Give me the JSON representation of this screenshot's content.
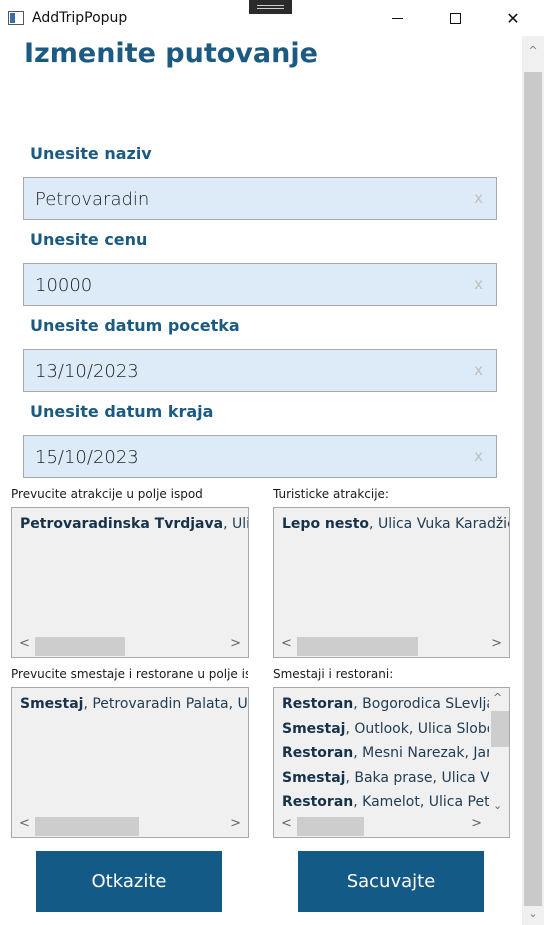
{
  "window": {
    "title": "AddTripPopup",
    "minimize_icon": "minimize-icon",
    "maximize_icon": "maximize-icon",
    "close_icon": "close-icon",
    "close_glyph": "✕"
  },
  "page": {
    "title": "Izmenite putovanje"
  },
  "fields": [
    {
      "label": "Unesite naziv",
      "value": "Petrovaradin",
      "clear": "x"
    },
    {
      "label": "Unesite cenu",
      "value": "10000",
      "clear": "x"
    },
    {
      "label": "Unesite datum pocetka",
      "value": "13/10/2023",
      "clear": "x"
    },
    {
      "label": "Unesite datum kraja",
      "value": "15/10/2023",
      "clear": "x"
    }
  ],
  "lists": {
    "selected_attractions": {
      "label": "Prevucite atrakcije u polje ispod",
      "items": [
        {
          "type": "Petrovaradinska Tvrdjava",
          "detail": ", Ulica Tr"
        }
      ]
    },
    "attractions": {
      "label": "Turisticke atrakcije:",
      "items": [
        {
          "type": "Lepo nesto",
          "detail": ", Ulica Vuka Karadžića"
        }
      ]
    },
    "selected_accommodations": {
      "label": "Prevucite smestaje i restorane u polje ispod",
      "items": [
        {
          "type": "Smestaj",
          "detail": ", Petrovaradin Palata, Ulic"
        }
      ]
    },
    "accommodations": {
      "label": "Smestaji i restorani:",
      "items": [
        {
          "type": "Restoran",
          "detail": ", Bogorodica SLevlja, U"
        },
        {
          "type": "Smestaj",
          "detail": ", Outlook, Ulica Slobod"
        },
        {
          "type": "Restoran",
          "detail": ", Mesni Narezak, Jarje"
        },
        {
          "type": "Smestaj",
          "detail": ", Baka prase, Ulica Vuk"
        },
        {
          "type": "Restoran",
          "detail": ", Kamelot, Ulica Petef"
        }
      ]
    }
  },
  "scroll_glyphs": {
    "left": "<",
    "right": ">",
    "up": "^",
    "down": "⌄"
  },
  "buttons": {
    "cancel": "Otkazite",
    "save": "Sacuvajte"
  },
  "colors": {
    "accent": "#145a86",
    "heading": "#1b5a82",
    "input_bg": "#dcebf7",
    "list_bg": "#f0f0f0"
  }
}
